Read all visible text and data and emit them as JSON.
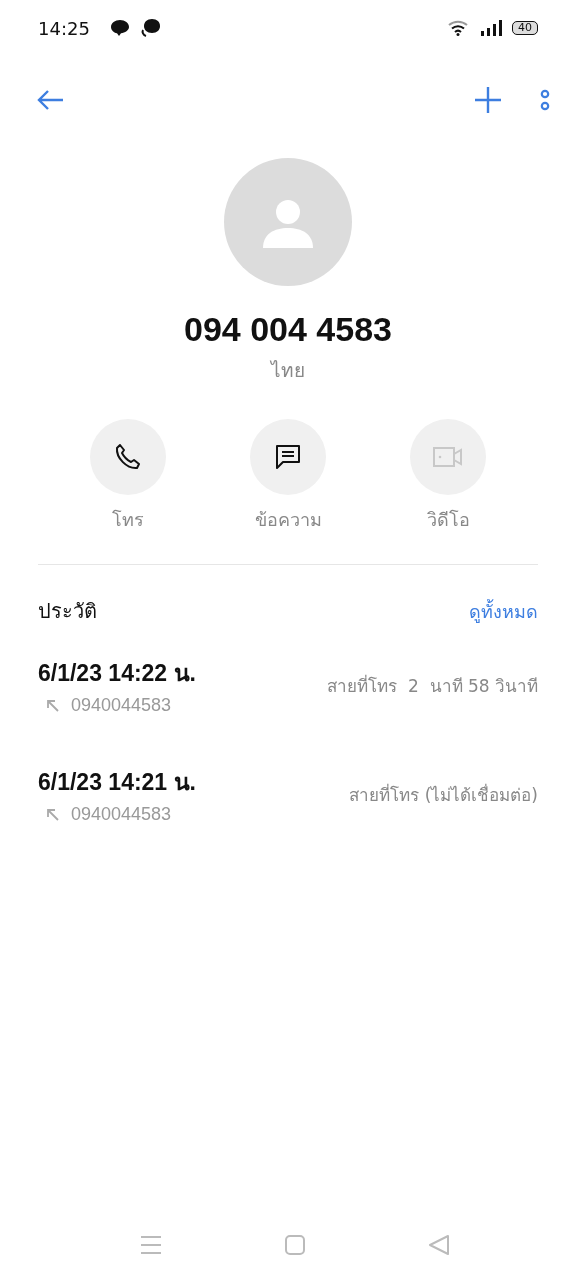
{
  "status_bar": {
    "time": "14:25",
    "battery": "40"
  },
  "contact": {
    "name": "094 004 4583",
    "location": "ไทย"
  },
  "actions": [
    {
      "kind": "call",
      "label": "โทร",
      "disabled": false
    },
    {
      "kind": "message",
      "label": "ข้อความ",
      "disabled": false
    },
    {
      "kind": "video",
      "label": "วิดีโอ",
      "disabled": true
    }
  ],
  "history": {
    "title": "ประวัติ",
    "see_all": "ดูทั้งหมด",
    "entries": [
      {
        "datetime": "6/1/23 14:22 น.",
        "number": "0940044583",
        "detail": "สายที่โทร  2  นาที 58 วินาที"
      },
      {
        "datetime": "6/1/23 14:21 น.",
        "number": "0940044583",
        "detail": "สายที่โทร (ไม่ได้เชื่อมต่อ)"
      }
    ]
  }
}
